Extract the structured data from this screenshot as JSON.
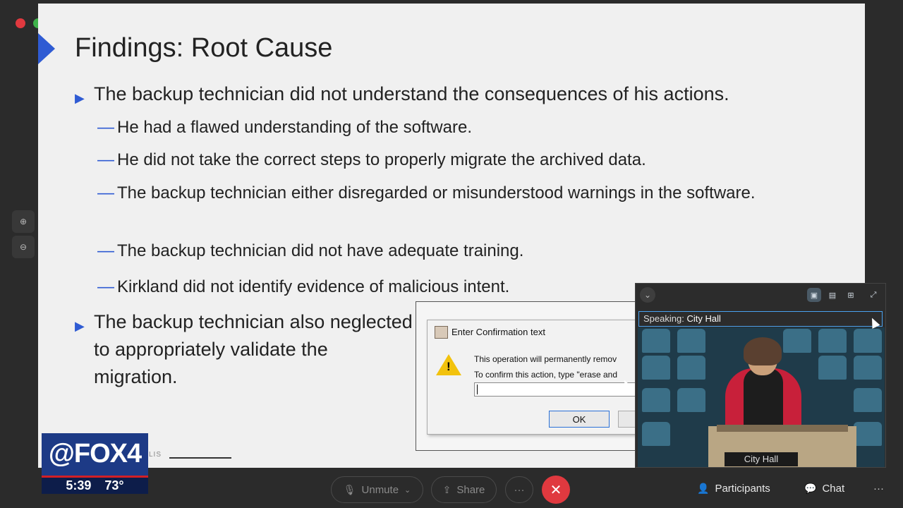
{
  "slide": {
    "title": "Findings: Root Cause",
    "bullets": [
      {
        "text": "The backup technician did not understand the consequences of his actions."
      },
      {
        "text": "He had a flawed understanding of the software."
      },
      {
        "text": "He did not take the correct steps to properly migrate the archived data."
      },
      {
        "text": "The backup technician either disregarded or misunderstood warnings in the software."
      },
      {
        "text": "The backup technician did not have adequate training."
      },
      {
        "text": "Kirkland did not identify evidence of malicious intent."
      },
      {
        "text": "The backup technician also neglected to appropriately validate the migration."
      }
    ],
    "markers": {
      "level1": "▶",
      "level2": "—"
    },
    "footer_logo": "LIS",
    "accent_color": "#2f5bd3"
  },
  "dialog": {
    "title": "Enter Confirmation text",
    "line1": "This operation will permanently remov",
    "line2": "To confirm this action, type \"erase and",
    "ok_label": "OK"
  },
  "video_panel": {
    "speaking_label": "Speaking:",
    "speaking_name": "City Hall",
    "participant_label": "City Hall"
  },
  "news_overlay": {
    "brand": "@FOX4",
    "time": "5:39",
    "temperature": "73°"
  },
  "toolbar": {
    "unmute": "Unmute",
    "share": "Share",
    "more": "···",
    "leave": "✕",
    "participants": "Participants",
    "chat": "Chat",
    "overflow": "···"
  }
}
